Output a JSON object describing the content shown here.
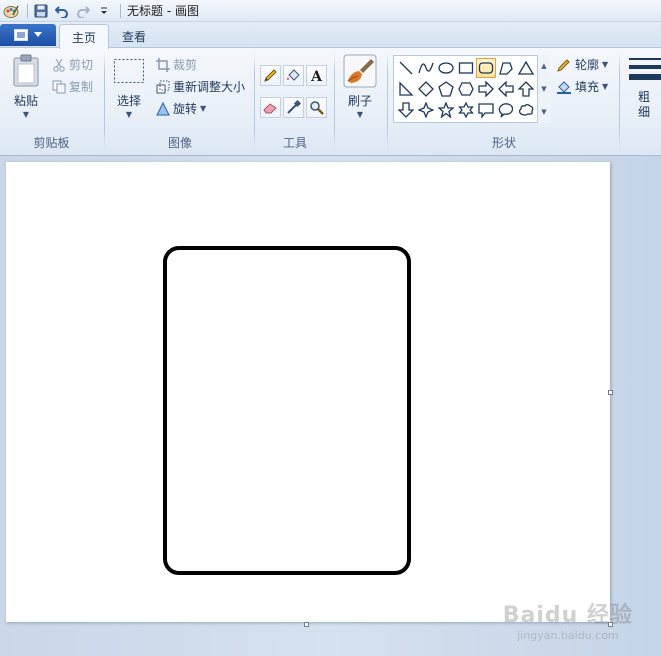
{
  "window": {
    "title": "无标题 - 画图"
  },
  "tabs": {
    "home": "主页",
    "view": "查看"
  },
  "clipboard": {
    "paste": "粘贴",
    "cut": "剪切",
    "copy": "复制",
    "label": "剪贴板"
  },
  "image": {
    "select": "选择",
    "crop": "裁剪",
    "resize": "重新调整大小",
    "rotate": "旋转",
    "label": "图像"
  },
  "tools": {
    "label": "工具",
    "items": [
      "pencil-icon",
      "fill-icon",
      "text-icon",
      "eraser-icon",
      "color-picker-icon",
      "magnifier-icon"
    ]
  },
  "brushes": {
    "label": "刷子"
  },
  "shapes": {
    "label": "形状",
    "outline": "轮廓",
    "fill": "填充",
    "selected": "rounded-rectangle"
  },
  "size": {
    "label": "粗\n细"
  },
  "watermark": {
    "main": "Baidu 经验",
    "sub": "jingyan.baidu.com"
  },
  "colors": {
    "accent": "#1c4ea5",
    "ribbon": "#f5f8fc",
    "selection": "#fde3a0"
  }
}
